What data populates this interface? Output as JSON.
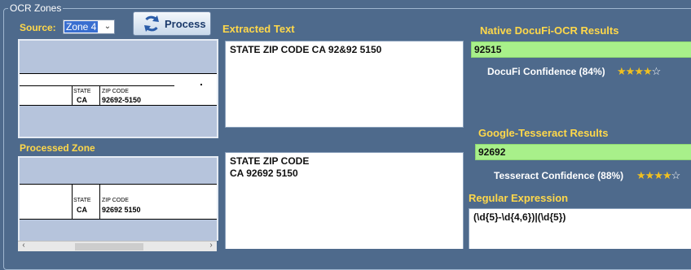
{
  "group": {
    "title": "OCR Zones"
  },
  "source": {
    "label": "Source:",
    "selected": "Zone 4"
  },
  "process_button": {
    "label": "Process"
  },
  "extracted": {
    "label": "Extracted Text",
    "text": "STATE ZIP CODE CA 92&92 5150"
  },
  "processed": {
    "label": "Processed Zone",
    "text": "STATE ZIP CODE\nCA 92692 5150"
  },
  "original_zone_image": {
    "state": "STATE",
    "ca": "CA",
    "zip_label": "ZIP CODE",
    "zip_value": "92692-5150"
  },
  "processed_zone_image": {
    "state": "STATE",
    "ca": "CA",
    "zip_label": "ZIP CODE",
    "zip_value": "92692 5150"
  },
  "native": {
    "label": "Native DocuFi-OCR Results",
    "value": "92515",
    "confidence_text": "DocuFi Confidence (84%)",
    "stars": 4,
    "max_stars": 5
  },
  "tesseract": {
    "label": "Google-Tesseract Results",
    "value": "92692",
    "confidence_text": "Tesseract Confidence (88%)",
    "stars": 4,
    "max_stars": 5
  },
  "regex": {
    "label": "Regular Expression",
    "value": "(\\d{5}-\\d{4,6})|(\\d{5})"
  },
  "colors": {
    "background": "#4e6a8c",
    "label_yellow": "#ffd84a",
    "result_green": "#a8f08a",
    "star_gold": "#f0c020"
  },
  "icons": {
    "process": "refresh-icon",
    "dropdown": "chevron-down-icon",
    "scroll_left": "scroll-left-arrow",
    "scroll_right": "scroll-right-arrow"
  }
}
